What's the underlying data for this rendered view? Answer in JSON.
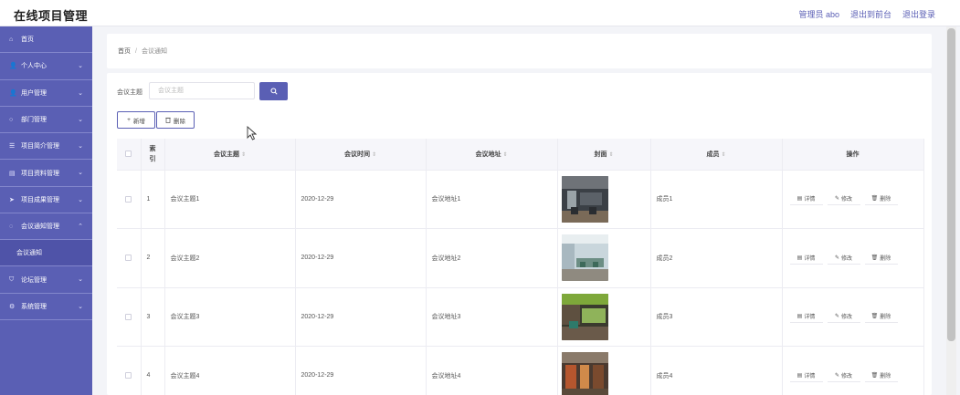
{
  "header": {
    "title": "在线项目管理",
    "links": [
      "管理员 abo",
      "退出到前台",
      "退出登录"
    ]
  },
  "sidebar": {
    "items": [
      {
        "label": "首页",
        "icon": "home-icon",
        "glyph": "⌂",
        "chevron": ""
      },
      {
        "label": "个人中心",
        "icon": "user-icon",
        "glyph": "👤",
        "chevron": "⌄"
      },
      {
        "label": "用户管理",
        "icon": "user-icon",
        "glyph": "👤",
        "chevron": "⌄"
      },
      {
        "label": "部门管理",
        "icon": "circle-icon",
        "glyph": "○",
        "chevron": "⌄"
      },
      {
        "label": "项目简介管理",
        "icon": "list-icon",
        "glyph": "☰",
        "chevron": "⌄"
      },
      {
        "label": "项目资料管理",
        "icon": "folder-icon",
        "glyph": "▤",
        "chevron": "⌄"
      },
      {
        "label": "项目成果管理",
        "icon": "send-icon",
        "glyph": "➤",
        "chevron": "⌄"
      },
      {
        "label": "会议通知管理",
        "icon": "circle-icon",
        "glyph": "◌",
        "chevron": "⌃"
      },
      {
        "label": "论坛管理",
        "icon": "shield-icon",
        "glyph": "⛉",
        "chevron": "⌄"
      },
      {
        "label": "系统管理",
        "icon": "gear-icon",
        "glyph": "⚙",
        "chevron": "⌄"
      }
    ],
    "submenu": "会议通知"
  },
  "breadcrumb": {
    "home": "首页",
    "sep": "/",
    "current": "会议通知"
  },
  "search": {
    "label": "会议主题",
    "placeholder": "会议主题"
  },
  "toolbar": {
    "add_label": "新增",
    "delete_label": "删除"
  },
  "table": {
    "headers": [
      "索引",
      "会议主题",
      "会议时间",
      "会议地址",
      "封面",
      "成员",
      "操作"
    ],
    "rows": [
      {
        "index": "1",
        "topic": "会议主题1",
        "time": "2020-12-29",
        "address": "会议地址1",
        "member": "成员1"
      },
      {
        "index": "2",
        "topic": "会议主题2",
        "time": "2020-12-29",
        "address": "会议地址2",
        "member": "成员2"
      },
      {
        "index": "3",
        "topic": "会议主题3",
        "time": "2020-12-29",
        "address": "会议地址3",
        "member": "成员3"
      },
      {
        "index": "4",
        "topic": "会议主题4",
        "time": "2020-12-29",
        "address": "会议地址4",
        "member": "成员4"
      }
    ],
    "actions": [
      "详情",
      "修改",
      "删除"
    ]
  },
  "colors": {
    "accent": "#5a5fb4",
    "sidebar_border": "#8387cc"
  }
}
